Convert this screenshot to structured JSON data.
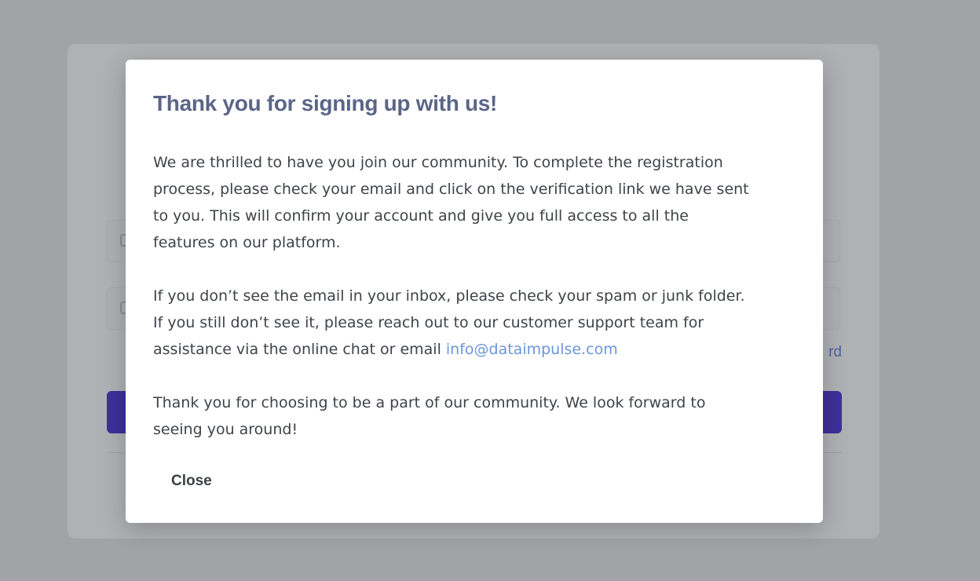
{
  "background": {
    "forgot_fragment": "rd"
  },
  "modal": {
    "title": "Thank you for signing up with us!",
    "paragraph1": {
      "lines": [
        "We are thrilled to have you join our community. To complete the registration",
        "process, please check your email and click on the verification link we have sent",
        "to you. This will confirm your account and give you full access to all the",
        "features on our platform."
      ]
    },
    "paragraph2": {
      "lines": [
        "If you don’t see the email in your inbox, please check your spam or junk folder.",
        "If you still don’t see it, please reach out to our customer support team for",
        "assistance via the online chat or email "
      ],
      "email": "info@dataimpulse.com"
    },
    "paragraph3": {
      "lines": [
        "Thank you for choosing to be a part of our community. We look forward to",
        "seeing you around!"
      ]
    },
    "close_label": "Close"
  },
  "colors": {
    "backdrop": "#a2a3a6",
    "title": "#5a6587",
    "body_text": "#3f4349",
    "link": "#6a96da",
    "primary_button": "#3f2f9a"
  }
}
